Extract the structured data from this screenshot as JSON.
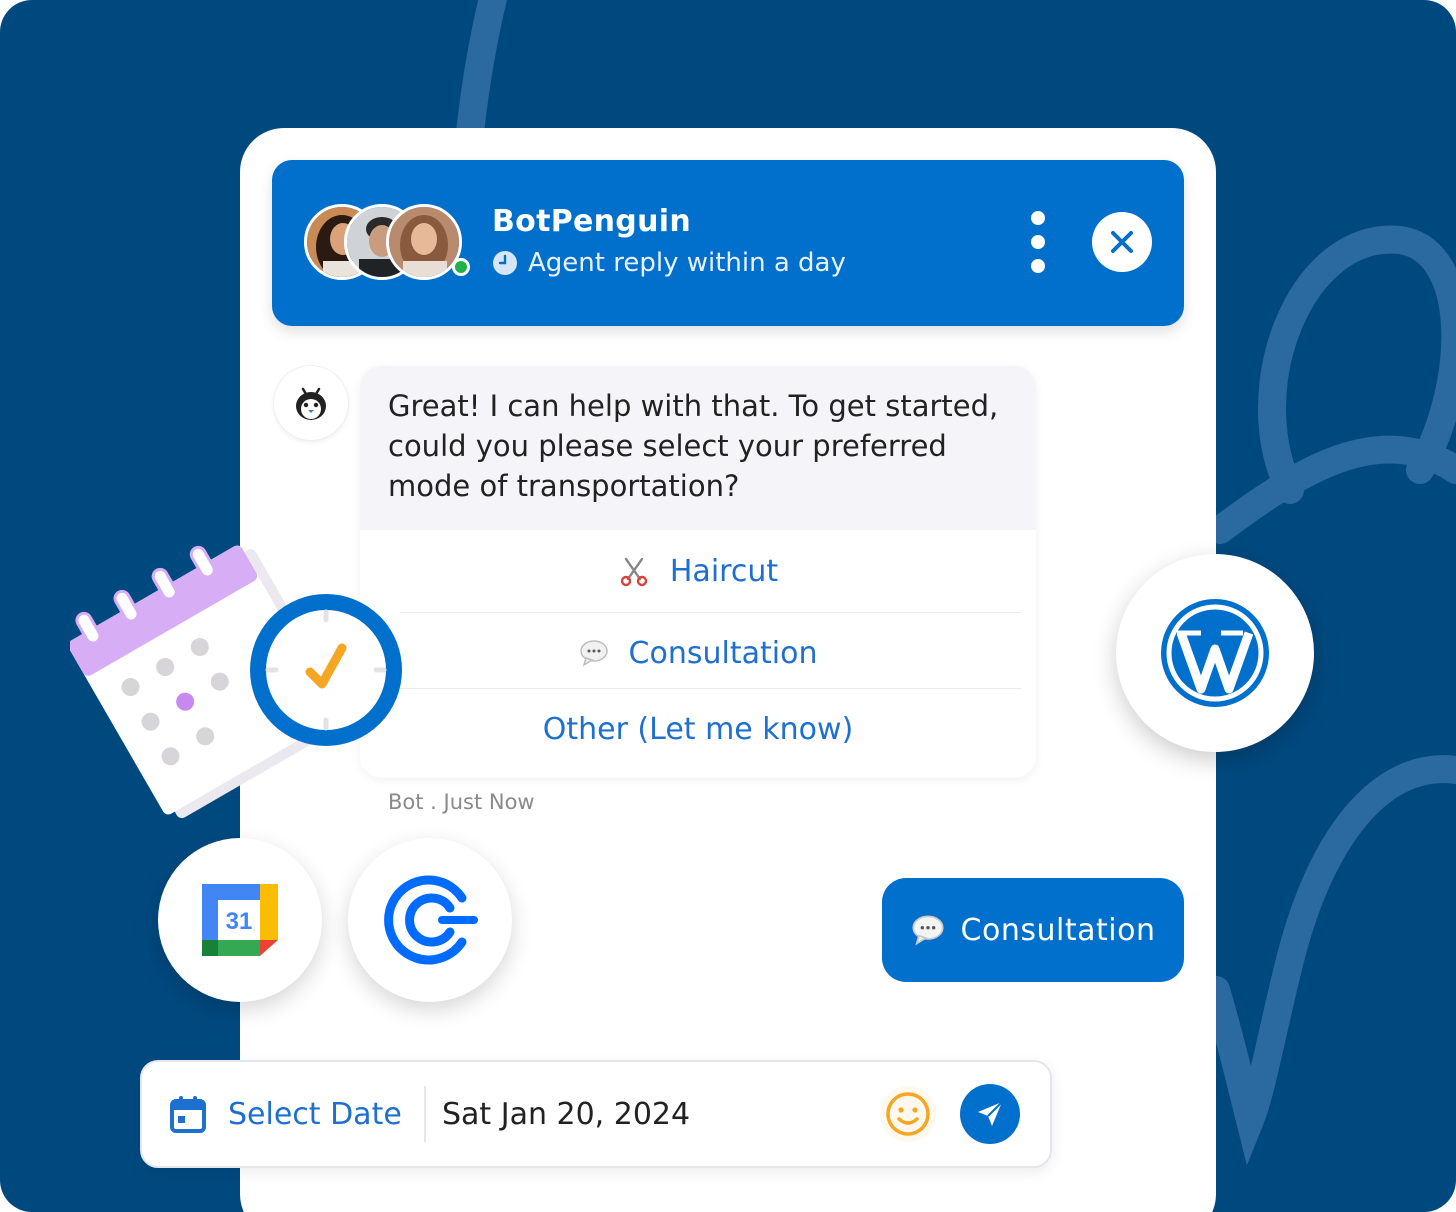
{
  "header": {
    "bot_name": "BotPenguin",
    "reply_status": "Agent reply within a day",
    "avatars": [
      "avatar-woman-1",
      "avatar-man",
      "avatar-woman-2"
    ],
    "online": true
  },
  "message": {
    "text": "Great! I can help with that. To get started, could you please select your preferred mode of transportation?",
    "options": [
      {
        "label": "Haircut",
        "icon": "scissors-icon"
      },
      {
        "label": "Consultation",
        "icon": "speech-bubble-icon"
      },
      {
        "label": "Other (Let me know)",
        "icon": ""
      }
    ],
    "meta": "Bot . Just Now"
  },
  "user_reply": {
    "label": "Consultation",
    "icon": "speech-bubble-icon"
  },
  "integrations": [
    "wordpress-icon",
    "google-calendar-icon",
    "calendly-icon",
    "calendar-clock-illustration"
  ],
  "google_calendar_day": "31",
  "input": {
    "select_date_label": "Select Date",
    "date_value": "Sat Jan 20, 2024"
  },
  "colors": {
    "background": "#00497f",
    "primary": "#0070cc",
    "link": "#1d6fd0",
    "accent_orange": "#f5a623"
  }
}
